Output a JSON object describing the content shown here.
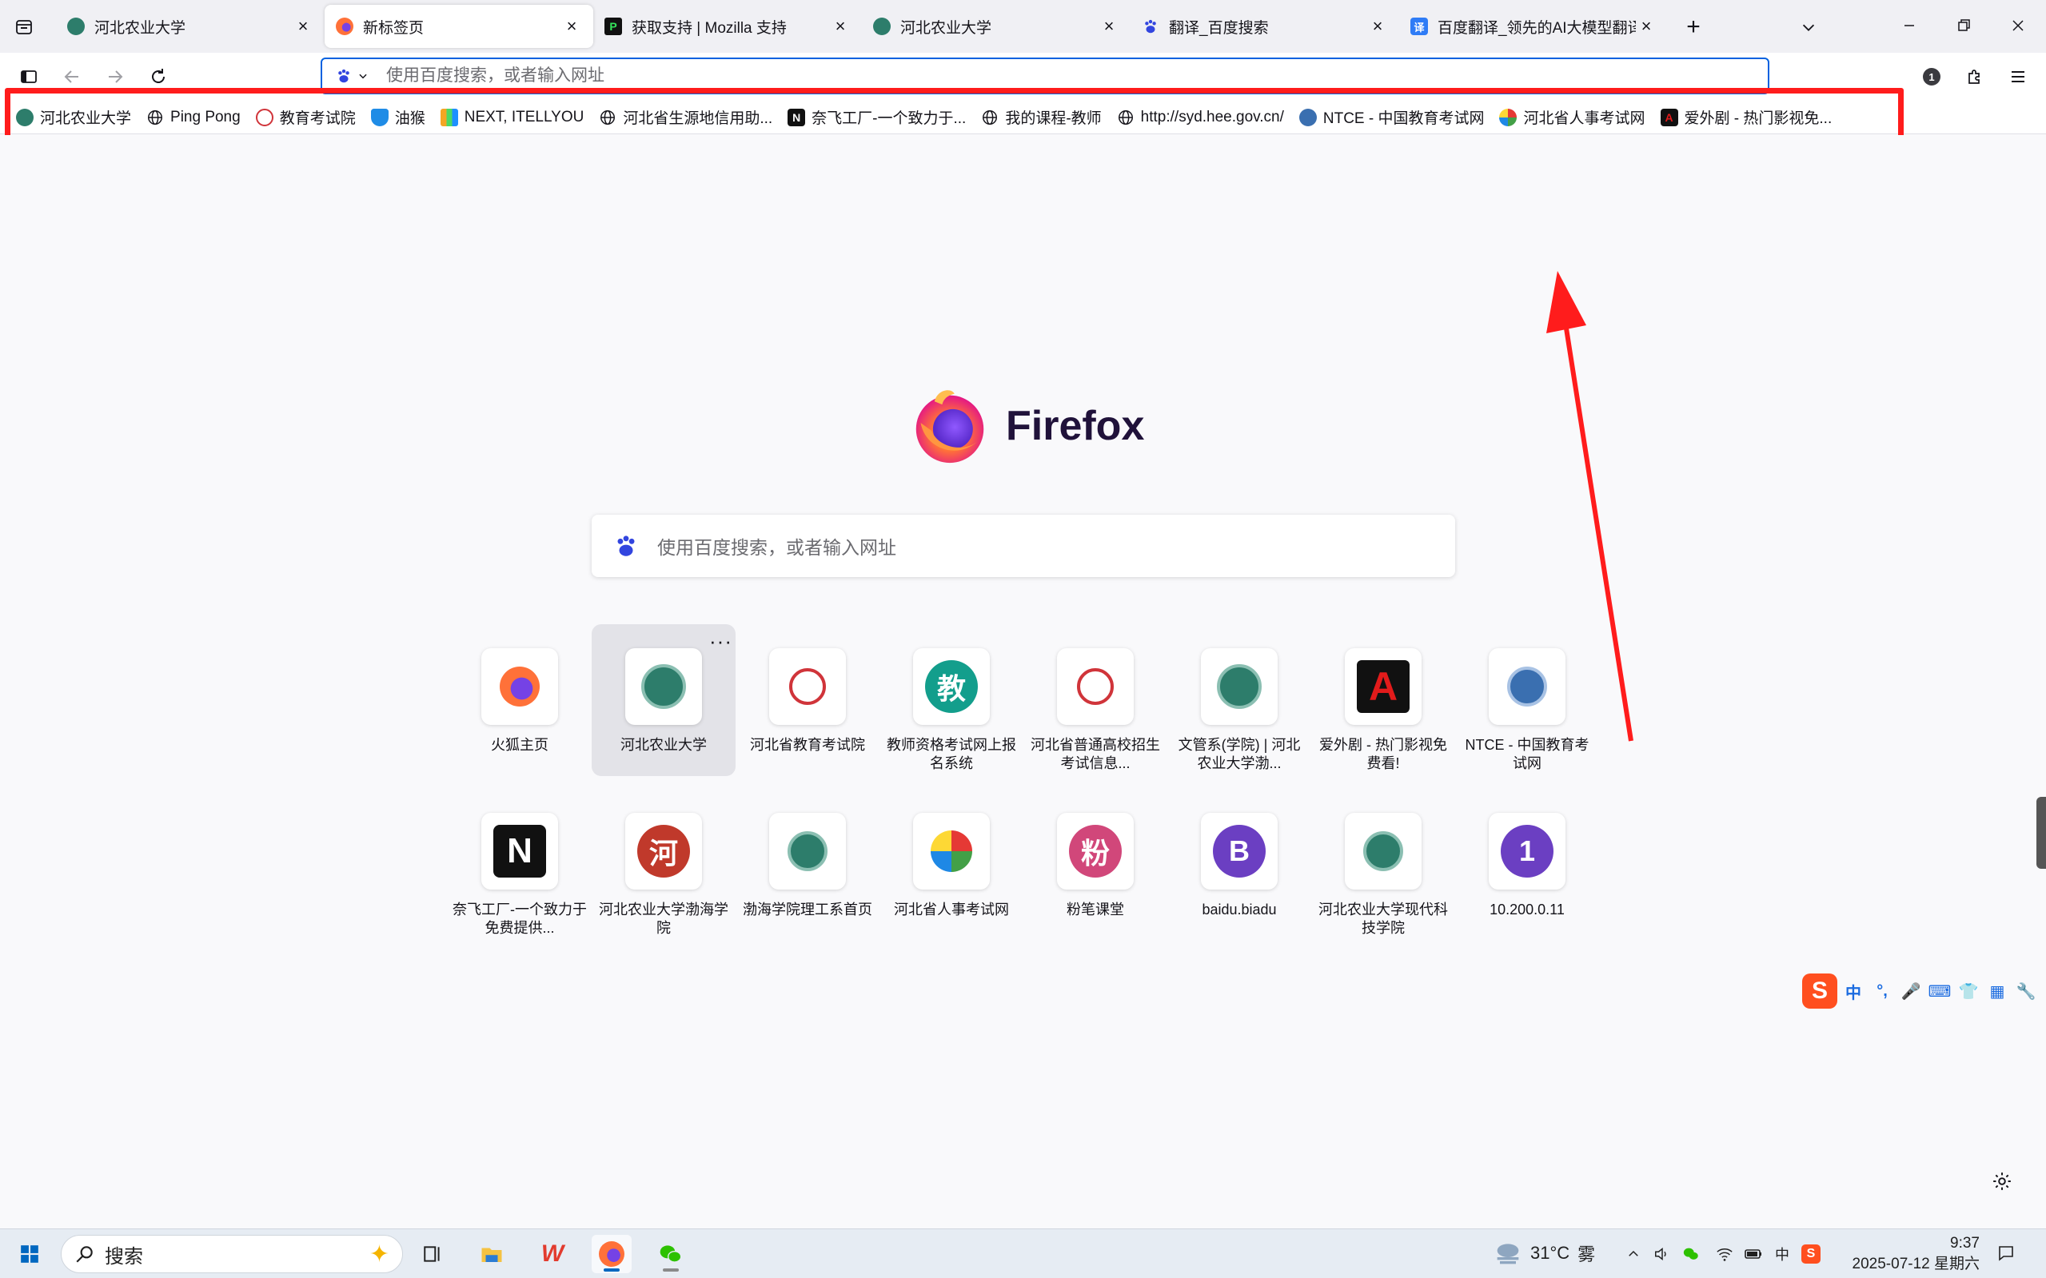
{
  "tabs": [
    {
      "title": "河北农业大学",
      "active": false
    },
    {
      "title": "新标签页",
      "active": true
    },
    {
      "title": "获取支持 | Mozilla 支持",
      "active": false
    },
    {
      "title": "河北农业大学",
      "active": false
    },
    {
      "title": "翻译_百度搜索",
      "active": false
    },
    {
      "title": "百度翻译_领先的AI大模型翻译_",
      "active": false
    }
  ],
  "urlbar": {
    "placeholder": "使用百度搜索，或者输入网址"
  },
  "toolbar": {
    "extensions_badge": "1"
  },
  "bookmarks": [
    {
      "label": "河北农业大学",
      "icon": "university-seal-icon"
    },
    {
      "label": "Ping Pong",
      "icon": "globe-icon"
    },
    {
      "label": "教育考试院",
      "icon": "exam-seal-icon"
    },
    {
      "label": "油猴",
      "icon": "tampermonkey-icon"
    },
    {
      "label": "NEXT, ITELLYOU",
      "icon": "next-itellyou-icon"
    },
    {
      "label": "河北省生源地信用助...",
      "icon": "globe-icon"
    },
    {
      "label": "奈飞工厂-一个致力于...",
      "icon": "notion-n-icon"
    },
    {
      "label": "我的课程-教师",
      "icon": "globe-icon"
    },
    {
      "label": "http://syd.hee.gov.cn/",
      "icon": "globe-icon"
    },
    {
      "label": "NTCE - 中国教育考试网",
      "icon": "ntce-seal-icon"
    },
    {
      "label": "河北省人事考试网",
      "icon": "colorful-logo-icon"
    },
    {
      "label": "爱外剧 - 热门影视免...",
      "icon": "red-a-icon"
    }
  ],
  "newtab": {
    "wordmark": "Firefox",
    "search_placeholder": "使用百度搜索，或者输入网址"
  },
  "shortcuts": [
    {
      "label": "火狐主页",
      "glyph": "",
      "icon": "firefox-icon"
    },
    {
      "label": "河北农业大学",
      "glyph": "",
      "icon": "university-seal-icon"
    },
    {
      "label": "河北省教育考试院",
      "glyph": "",
      "icon": "exam-seal-icon"
    },
    {
      "label": "教师资格考试网上报名系统",
      "glyph": "教",
      "icon": "teacher-cert-icon"
    },
    {
      "label": "河北省普通高校招生考试信息...",
      "glyph": "",
      "icon": "exam-seal-icon"
    },
    {
      "label": "文管系(学院) | 河北农业大学渤...",
      "glyph": "",
      "icon": "university-seal-icon"
    },
    {
      "label": "爱外剧 - 热门影视免费看!",
      "glyph": "A",
      "icon": "red-a-icon"
    },
    {
      "label": "NTCE - 中国教育考试网",
      "glyph": "",
      "icon": "ntce-seal-icon"
    },
    {
      "label": "奈飞工厂-一个致力于免费提供...",
      "glyph": "N",
      "icon": "notion-n-icon"
    },
    {
      "label": "河北农业大学渤海学院",
      "glyph": "河",
      "icon": "letter-he-icon"
    },
    {
      "label": "渤海学院理工系首页",
      "glyph": "",
      "icon": "university-seal-icon"
    },
    {
      "label": "河北省人事考试网",
      "glyph": "",
      "icon": "colorful-logo-icon"
    },
    {
      "label": "粉笔课堂",
      "glyph": "粉",
      "icon": "letter-fen-icon"
    },
    {
      "label": "baidu.biadu",
      "glyph": "B",
      "icon": "letter-b-icon"
    },
    {
      "label": "河北农业大学现代科技学院",
      "glyph": "",
      "icon": "university-seal-icon"
    },
    {
      "label": "10.200.0.11",
      "glyph": "1",
      "icon": "letter-1-icon"
    }
  ],
  "ime": {
    "logo": "S",
    "items": [
      "中",
      "°,",
      "🎤",
      "⌨",
      "👕",
      "▦",
      "🔧"
    ]
  },
  "taskbar": {
    "search_label": "搜索",
    "weather_temp": "31°C",
    "weather_desc": "雾",
    "tray_ime": "中",
    "time": "9:37",
    "date": "2025-07-12 星期六"
  },
  "colors": {
    "accent": "#0061e0",
    "highlight": "#ff1c1c",
    "teacher": "#139e8c",
    "he": "#c0392b",
    "fen": "#d1477a",
    "b": "#6b3fc2",
    "one": "#6b3fc2"
  }
}
